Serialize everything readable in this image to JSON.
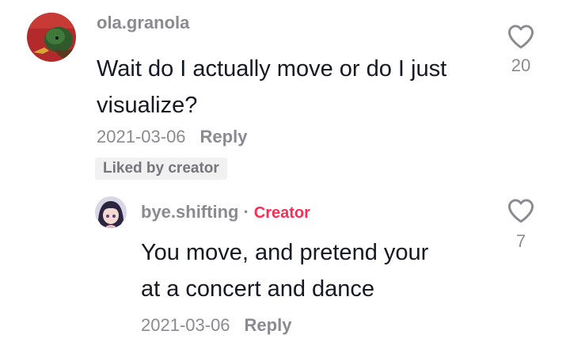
{
  "comments": [
    {
      "username": "ola.granola",
      "text_line1": "Wait do I actually move or do I just",
      "text_line2": "visualize?",
      "date": "2021-03-06",
      "reply_label": "Reply",
      "badge": "Liked by creator",
      "likes": "20"
    }
  ],
  "reply": {
    "username": "bye.shifting",
    "separator": "·",
    "creator_label": "Creator",
    "text_line1": "You move, and pretend your",
    "text_line2": "at a concert and dance",
    "date": "2021-03-06",
    "reply_label": "Reply",
    "likes": "7"
  },
  "colors": {
    "accent_creator": "#fe2c55",
    "muted_text": "#8a8b91",
    "primary_text": "#161823"
  },
  "icons": {
    "like": "heart-outline-icon"
  }
}
